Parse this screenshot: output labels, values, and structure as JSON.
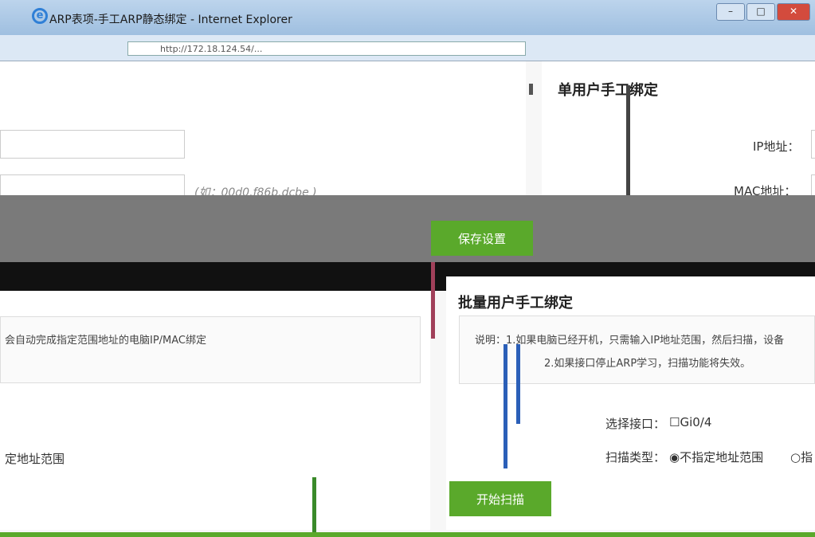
{
  "window": {
    "title": "ARP表项-手工ARP静态绑定 - Internet Explorer"
  },
  "address_bar": {
    "url": "http://172.18.124.54/..."
  },
  "single_binding": {
    "title": "单用户手工绑定",
    "ip_label": "IP地址：",
    "mac_label": "MAC地址：",
    "mac_hint": "(如：00d0.f86b.dcbe )",
    "save_button": "保存设置"
  },
  "batch_binding": {
    "title": "批量用户手工绑定",
    "note_line1": "说明：1.如果电脑已经开机，只需输入IP地址范围，然后扫描，设备",
    "note_line2": "2.如果接口停止ARP学习，扫描功能将失效。",
    "left_note": "会自动完成指定范围地址的电脑IP/MAC绑定",
    "interface_label": "选择接口：",
    "interface_option": "☐Gi0/4",
    "scan_type_label": "扫描类型：",
    "scan_option_selected": "◉不指定地址范围",
    "scan_option_other": "○指",
    "left_scan_text": "定地址范围",
    "start_button": "开始扫描"
  }
}
